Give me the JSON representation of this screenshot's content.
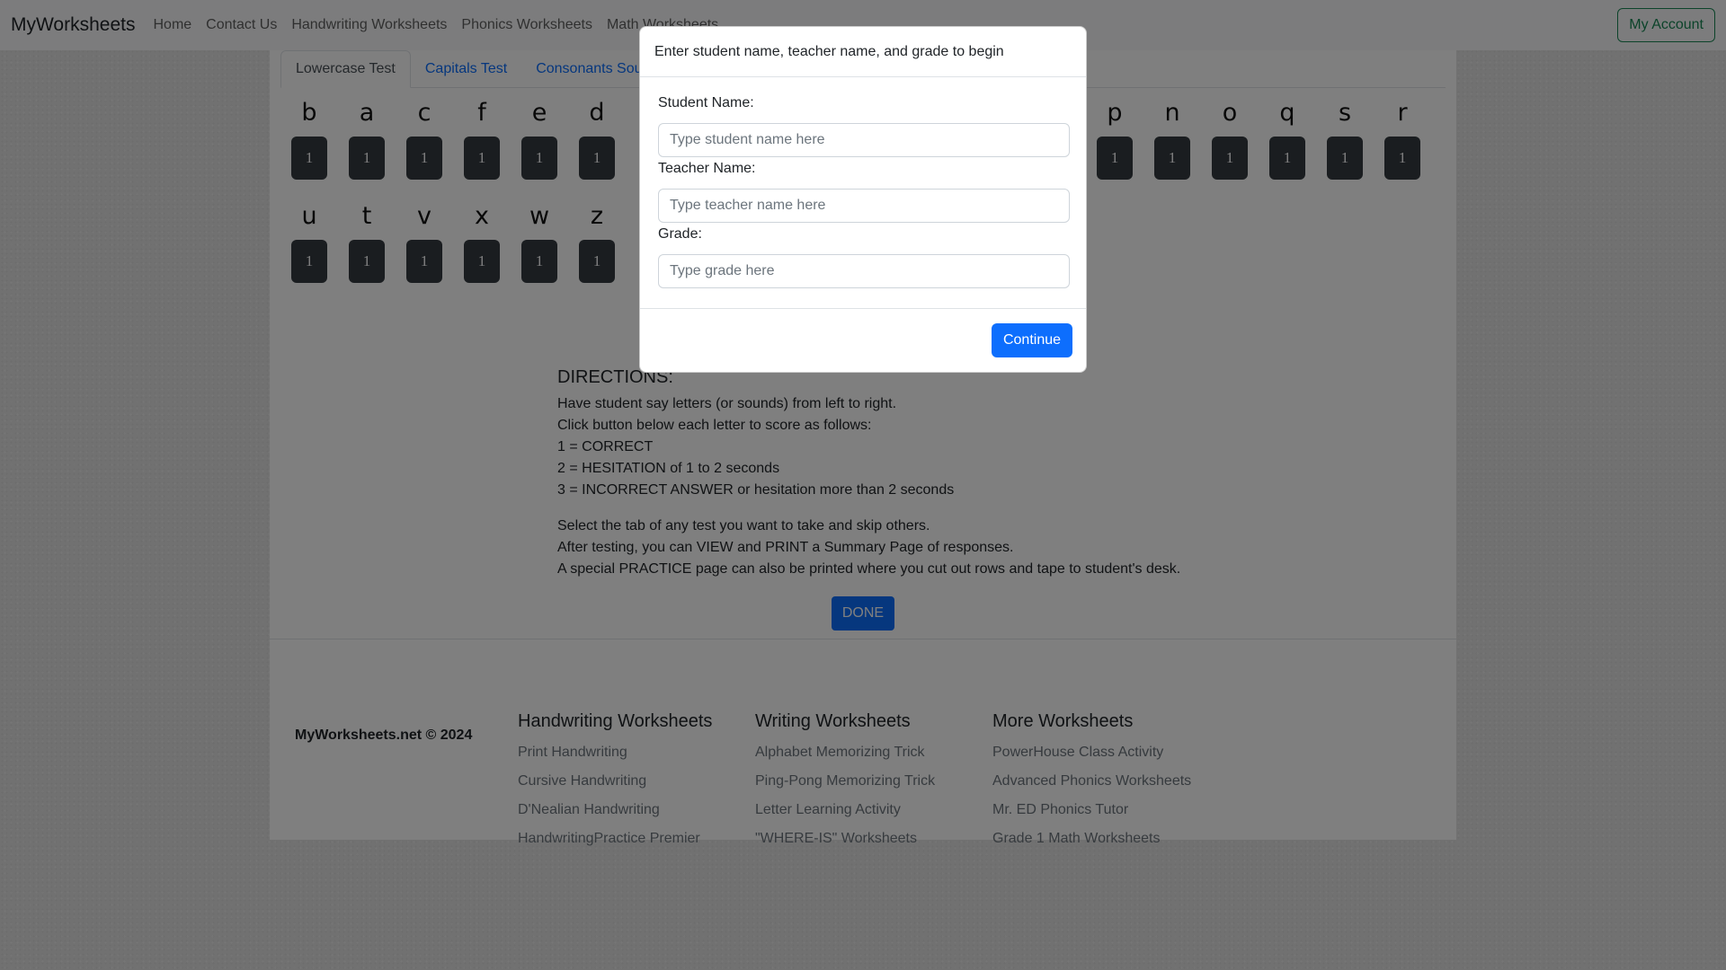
{
  "navbar": {
    "brand": "MyWorksheets",
    "links": [
      "Home",
      "Contact Us",
      "Handwriting Worksheets",
      "Phonics Worksheets",
      "Math Worksheets"
    ],
    "account_label": "My Account"
  },
  "tabs": [
    {
      "label": "Lowercase Test",
      "active": true
    },
    {
      "label": "Capitals Test",
      "active": false
    },
    {
      "label": "Consonants Sounds",
      "active": false
    }
  ],
  "letters_row1_left": [
    "b",
    "a",
    "c",
    "f",
    "e",
    "d"
  ],
  "letters_row1_right": [
    "p",
    "n",
    "o",
    "q",
    "s",
    "r"
  ],
  "letters_row2_left": [
    "u",
    "t",
    "v",
    "x",
    "w",
    "z"
  ],
  "score_value": "1",
  "directions": {
    "heading": "DIRECTIONS:",
    "lines": [
      "Have student say letters (or sounds) from left to right.",
      "Click button below each letter to score as follows:",
      "1 = CORRECT",
      "2 = HESITATION of 1 to 2 seconds",
      "3 = INCORRECT ANSWER or hesitation more than 2 seconds"
    ],
    "lines2": [
      "Select the tab of any test you want to take and skip others.",
      "After testing, you can VIEW and PRINT a Summary Page of responses.",
      "A special PRACTICE page can also be printed where you cut out rows and tape to student's desk."
    ]
  },
  "done_label": "DONE",
  "footer": {
    "copyright": "MyWorksheets.net © 2024",
    "columns": [
      {
        "title": "Handwriting Worksheets",
        "links": [
          "Print Handwriting",
          "Cursive Handwriting",
          "D'Nealian Handwriting",
          "HandwritingPractice Premier"
        ]
      },
      {
        "title": "Writing Worksheets",
        "links": [
          "Alphabet Memorizing Trick",
          "Ping-Pong Memorizing Trick",
          "Letter Learning Activity",
          "\"WHERE-IS\" Worksheets"
        ]
      },
      {
        "title": "More Worksheets",
        "links": [
          "PowerHouse Class Activity",
          "Advanced Phonics Worksheets",
          "Mr. ED Phonics Tutor",
          "Grade 1 Math Worksheets"
        ]
      }
    ]
  },
  "modal": {
    "title": "Enter student name, teacher name, and grade to begin",
    "student_label": "Student Name:",
    "student_placeholder": "Type student name here",
    "teacher_label": "Teacher Name:",
    "teacher_placeholder": "Type teacher name here",
    "grade_label": "Grade:",
    "grade_placeholder": "Type grade here",
    "continue_label": "Continue"
  },
  "colors": {
    "primary": "#0d6efd",
    "score_button": "#343a40",
    "account_outline": "#198754"
  }
}
